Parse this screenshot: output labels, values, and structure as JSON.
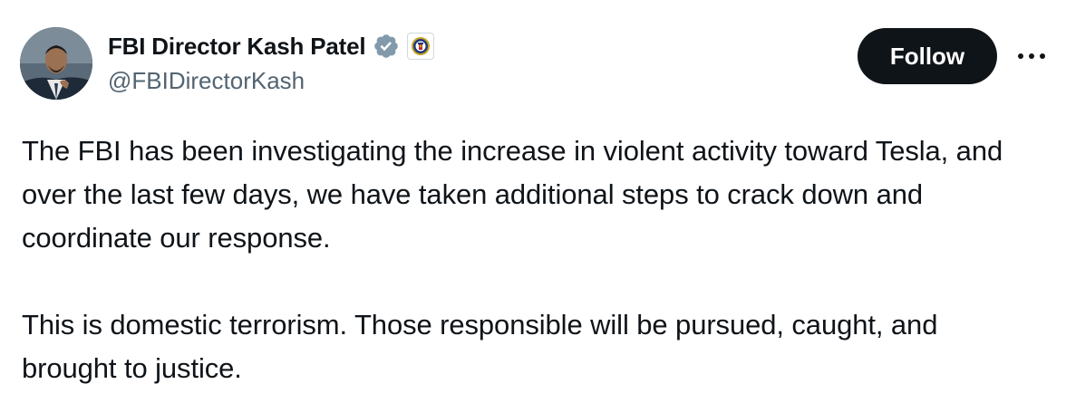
{
  "author": {
    "display_name": "FBI Director Kash Patel",
    "handle": "@FBIDirectorKash",
    "avatar_icon": "profile-photo",
    "verified_badge_icon": "verified-gray-badge-icon",
    "affiliate_badge_icon": "fbi-seal-icon",
    "verified_color": "#829aab"
  },
  "actions": {
    "follow_label": "Follow",
    "more_icon": "more-horizontal-icon"
  },
  "tweet": {
    "paragraphs": [
      "The FBI has been investigating the increase in violent activity toward Tesla, and over the last few days, we have taken additional steps to crack down and coordinate our response.",
      "This is domestic terrorism. Those responsible will be pursued, caught, and brought to justice."
    ]
  },
  "colors": {
    "text_primary": "#0f1419",
    "text_secondary": "#536471",
    "button_bg": "#0f1419",
    "button_text": "#ffffff"
  }
}
